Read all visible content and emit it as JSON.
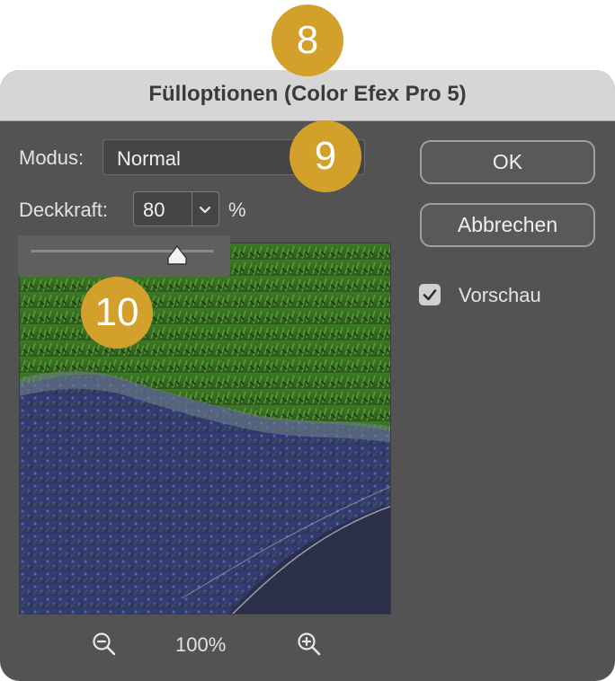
{
  "dialog": {
    "title": "Fülloptionen (Color Efex Pro 5)",
    "mode_label": "Modus:",
    "mode_value": "Normal",
    "opacity_label": "Deckkraft:",
    "opacity_value": "80",
    "opacity_unit": "%",
    "opacity_slider_value": 0.8,
    "ok_label": "OK",
    "cancel_label": "Abbrechen",
    "preview_label": "Vorschau",
    "preview_checked": true,
    "zoom_level": "100%",
    "zoom_out_icon": "zoom-out-icon",
    "zoom_in_icon": "zoom-in-icon",
    "checkmark_icon": "checkmark-icon",
    "chevron_icon": "chevron-down-icon"
  },
  "callouts": [
    "8",
    "9",
    "10"
  ],
  "colors": {
    "dialog_bg": "#535353",
    "titlebar_bg": "#d6d6d6",
    "badge": "#d3a02b",
    "foliage_green": "#2f6a1c",
    "lavender_blue": "#3a3f7e"
  }
}
